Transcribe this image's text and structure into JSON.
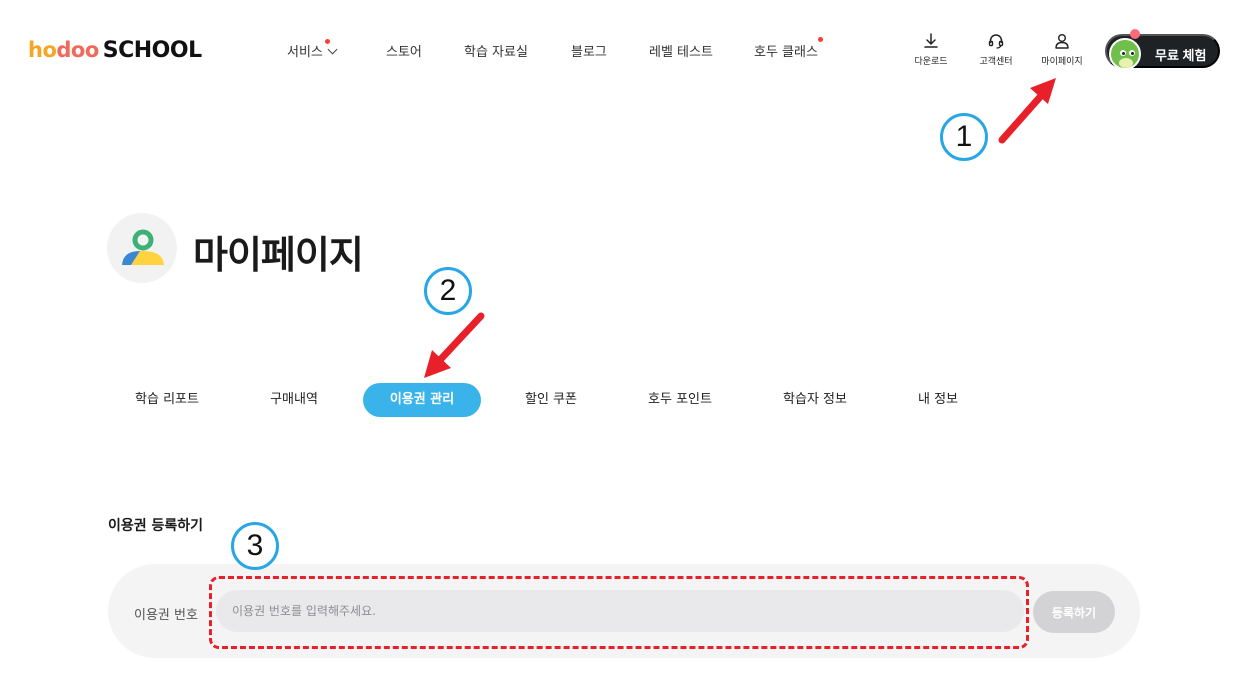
{
  "brand": {
    "logo_part1": "ho",
    "logo_part2": "doo",
    "logo_part3": "SCHOOL"
  },
  "nav": [
    {
      "label": "서비스",
      "has_dot": true,
      "has_chevron": true
    },
    {
      "label": "스토어"
    },
    {
      "label": "학습 자료실"
    },
    {
      "label": "블로그"
    },
    {
      "label": "레벨 테스트"
    },
    {
      "label": "호두 클래스",
      "has_dot": true
    }
  ],
  "utility": [
    {
      "label": "다운로드",
      "icon": "download-icon"
    },
    {
      "label": "고객센터",
      "icon": "headset-icon"
    },
    {
      "label": "마이페이지",
      "icon": "user-icon"
    }
  ],
  "trial_button": {
    "label": "무료 체험"
  },
  "page": {
    "title": "마이페이지"
  },
  "tabs": [
    {
      "label": "학습 리포트",
      "active": false
    },
    {
      "label": "구매내역",
      "active": false
    },
    {
      "label": "이용권 관리",
      "active": true
    },
    {
      "label": "할인 쿠폰",
      "active": false
    },
    {
      "label": "호두 포인트",
      "active": false
    },
    {
      "label": "학습자 정보",
      "active": false
    },
    {
      "label": "내 정보",
      "active": false
    }
  ],
  "coupon": {
    "section_title": "이용권 등록하기",
    "field_label": "이용권 번호",
    "placeholder": "이용권 번호를 입력해주세요.",
    "value": "",
    "register_label": "등록하기"
  },
  "annotations": {
    "step1": "1",
    "step2": "2",
    "step3": "3"
  },
  "colors": {
    "accent": "#39b3ea",
    "dark_button": "#1f2225",
    "annotation_red": "#e8202a",
    "annotation_circle": "#29a6e5"
  }
}
